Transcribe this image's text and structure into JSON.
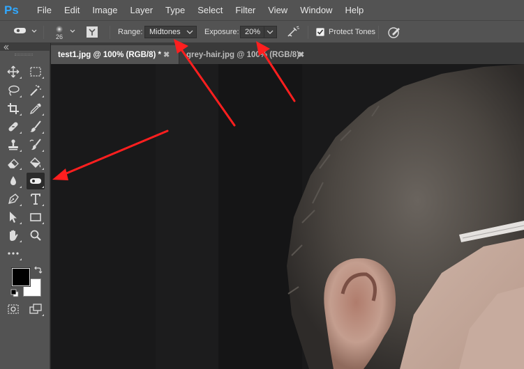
{
  "app": {
    "logo": "Ps"
  },
  "menu": [
    "File",
    "Edit",
    "Image",
    "Layer",
    "Type",
    "Select",
    "Filter",
    "View",
    "Window",
    "Help"
  ],
  "options": {
    "brush_size": "26",
    "range_label": "Range:",
    "range_value": "Midtones",
    "exposure_label": "Exposure:",
    "exposure_value": "20%",
    "protect_tones_label": "Protect Tones",
    "protect_tones_checked": true
  },
  "tabs": [
    {
      "label": "test1.jpg @ 100% (RGB/8) *",
      "active": true
    },
    {
      "label": "grey-hair.jpg @ 100% (RGB/8)",
      "active": false
    }
  ],
  "tools": [
    "move",
    "marquee",
    "lasso",
    "magic-wand",
    "crop",
    "eyedropper",
    "healing",
    "brush",
    "clone-stamp",
    "history-brush",
    "eraser",
    "paint-bucket",
    "blur",
    "dodge",
    "pen",
    "type",
    "path-selection",
    "rectangle",
    "hand",
    "zoom",
    "more",
    "swap-colors",
    "foreground-color",
    "background-color",
    "default-colors",
    "quick-mask",
    "screen-mode"
  ],
  "colors": {
    "foreground": "#000000",
    "background": "#ffffff",
    "annotation_arrow": "#ff1f1f",
    "logo": "#31a8ff"
  }
}
